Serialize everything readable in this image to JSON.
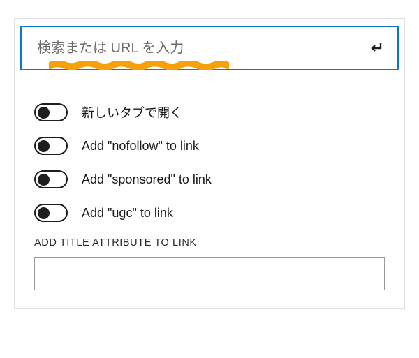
{
  "search": {
    "placeholder": "検索または URL を入力",
    "value": ""
  },
  "toggles": [
    {
      "label": "新しいタブで開く",
      "on": false
    },
    {
      "label": "Add \"nofollow\" to link",
      "on": false
    },
    {
      "label": "Add \"sponsored\" to link",
      "on": false
    },
    {
      "label": "Add \"ugc\" to link",
      "on": false
    }
  ],
  "title_section": {
    "heading": "ADD TITLE ATTRIBUTE TO LINK",
    "value": ""
  },
  "colors": {
    "focus_border": "#0a78c2",
    "highlight": "#f7a10a"
  }
}
